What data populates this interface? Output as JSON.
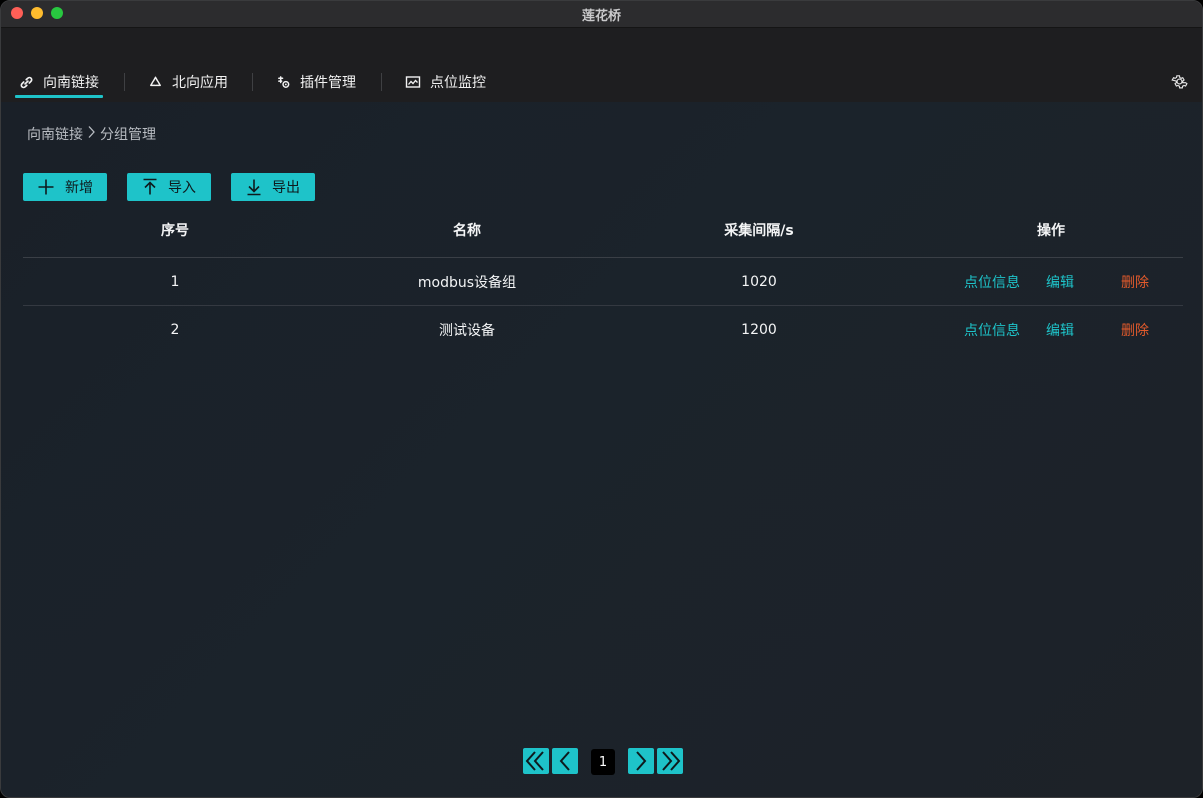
{
  "window": {
    "title": "莲花桥"
  },
  "nav": {
    "items": [
      {
        "label": "向南链接",
        "icon": "link-icon",
        "active": true
      },
      {
        "label": "北向应用",
        "icon": "recycle-icon",
        "active": false
      },
      {
        "label": "插件管理",
        "icon": "plugin-icon",
        "active": false
      },
      {
        "label": "点位监控",
        "icon": "monitor-icon",
        "active": false
      }
    ],
    "settings_icon": "gear-icon"
  },
  "breadcrumb": {
    "parent": "向南链接",
    "separator": ">",
    "current": "分组管理"
  },
  "toolbar": {
    "add_label": "新增",
    "import_label": "导入",
    "export_label": "导出"
  },
  "table": {
    "headers": [
      "序号",
      "名称",
      "采集间隔/s",
      "操作"
    ],
    "rows": [
      {
        "index": "1",
        "name": "modbus设备组",
        "interval": "1020",
        "info": "点位信息",
        "edit": "编辑",
        "delete": "删除"
      },
      {
        "index": "2",
        "name": "测试设备",
        "interval": "1200",
        "info": "点位信息",
        "edit": "编辑",
        "delete": "删除"
      }
    ]
  },
  "pagination": {
    "current_page": "1"
  },
  "colors": {
    "accent": "#1ec3c9",
    "danger": "#e25a2c"
  }
}
